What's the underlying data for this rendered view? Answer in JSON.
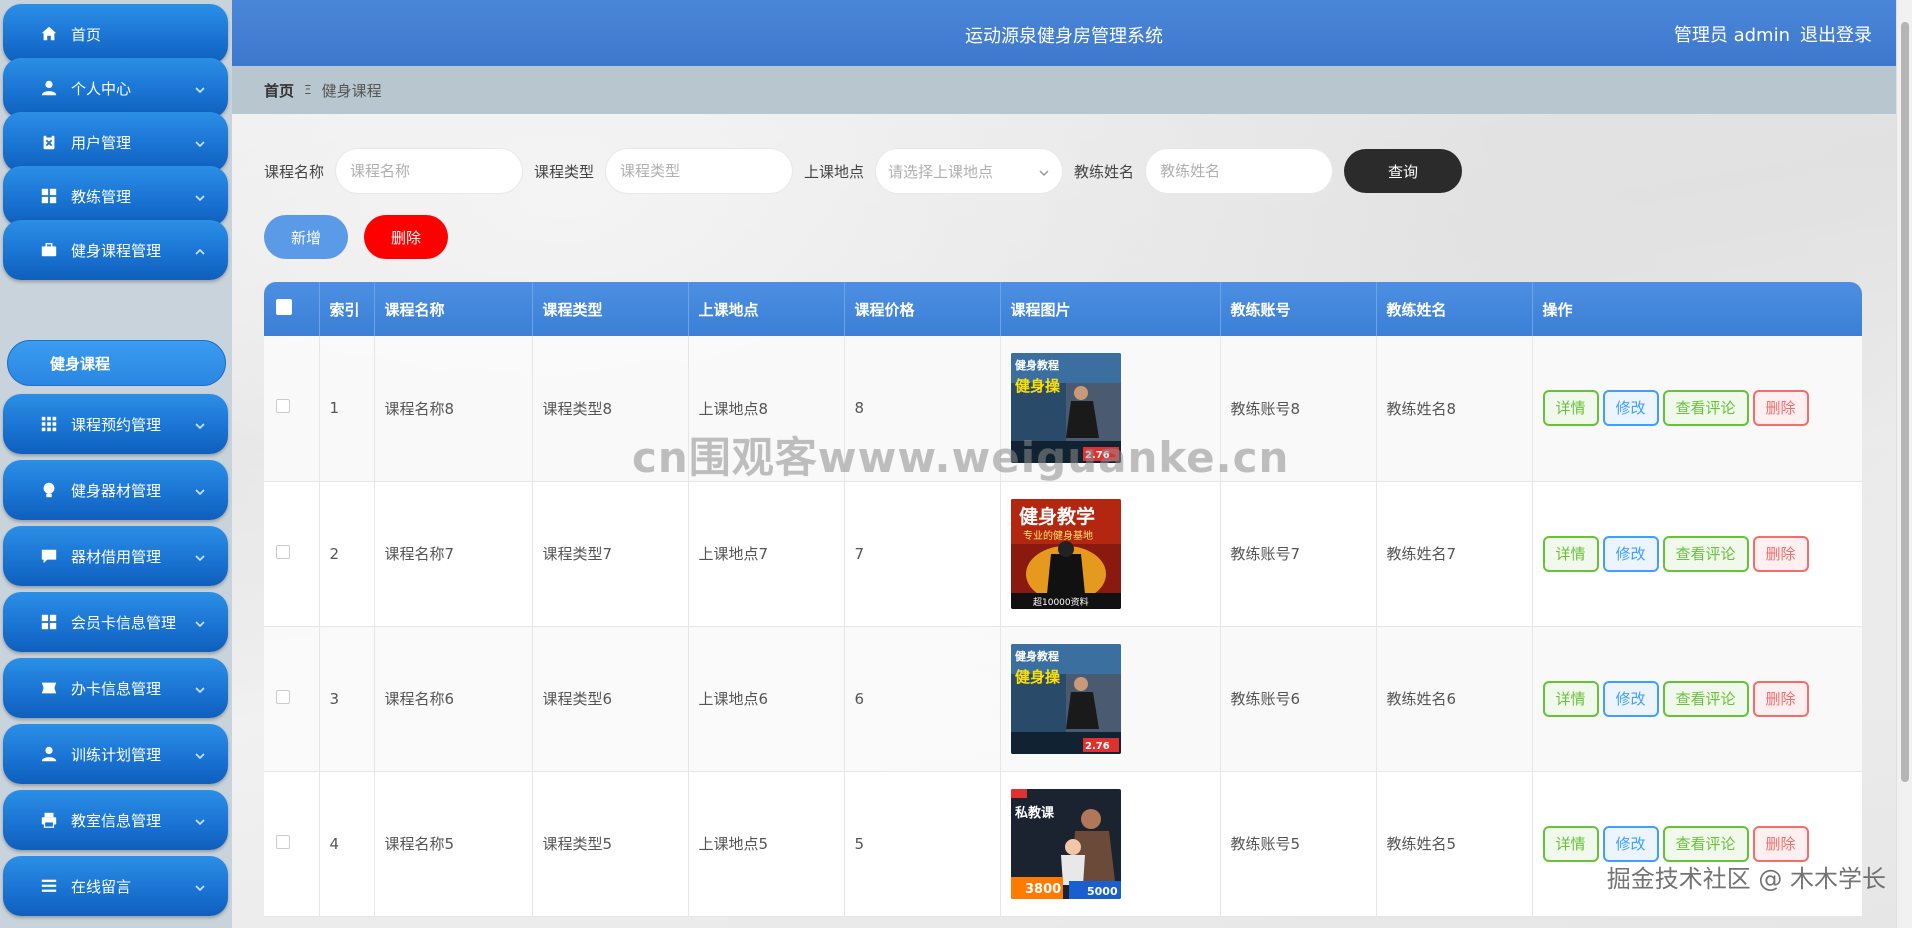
{
  "sidebar": {
    "items": [
      {
        "label": "首页",
        "icon": "home-icon"
      },
      {
        "label": "个人中心",
        "icon": "user-icon"
      },
      {
        "label": "用户管理",
        "icon": "clipboard-icon"
      },
      {
        "label": "教练管理",
        "icon": "grid-icon"
      },
      {
        "label": "健身课程管理",
        "icon": "briefcase-icon"
      },
      {
        "label": "课程预约管理",
        "icon": "apps-icon"
      },
      {
        "label": "健身器材管理",
        "icon": "bulb-icon"
      },
      {
        "label": "器材借用管理",
        "icon": "chat-icon"
      },
      {
        "label": "会员卡信息管理",
        "icon": "grid-icon"
      },
      {
        "label": "办卡信息管理",
        "icon": "ticket-icon"
      },
      {
        "label": "训练计划管理",
        "icon": "user-icon"
      },
      {
        "label": "教室信息管理",
        "icon": "printer-icon"
      },
      {
        "label": "在线留言",
        "icon": "list-icon"
      }
    ],
    "sub_item": "健身课程"
  },
  "header": {
    "title": "运动源泉健身房管理系统",
    "user": "管理员 admin",
    "logout": "退出登录"
  },
  "breadcrumb": {
    "home": "首页",
    "separator": "Ξ",
    "current": "健身课程"
  },
  "search": {
    "name_label": "课程名称",
    "name_placeholder": "课程名称",
    "type_label": "课程类型",
    "type_placeholder": "课程类型",
    "place_label": "上课地点",
    "place_placeholder": "请选择上课地点",
    "coach_label": "教练姓名",
    "coach_placeholder": "教练姓名",
    "query_button": "查询"
  },
  "actions": {
    "add": "新增",
    "delete": "删除"
  },
  "table": {
    "columns": [
      "索引",
      "课程名称",
      "课程类型",
      "上课地点",
      "课程价格",
      "课程图片",
      "教练账号",
      "教练姓名",
      "操作"
    ],
    "rows": [
      {
        "index": "1",
        "name": "课程名称8",
        "type": "课程类型8",
        "place": "上课地点8",
        "price": "8",
        "image": "fitness-poster-1",
        "account": "教练账号8",
        "coach": "教练姓名8"
      },
      {
        "index": "2",
        "name": "课程名称7",
        "type": "课程类型7",
        "place": "上课地点7",
        "price": "7",
        "image": "fitness-poster-2",
        "account": "教练账号7",
        "coach": "教练姓名7"
      },
      {
        "index": "3",
        "name": "课程名称6",
        "type": "课程类型6",
        "place": "上课地点6",
        "price": "6",
        "image": "fitness-poster-1",
        "account": "教练账号6",
        "coach": "教练姓名6"
      },
      {
        "index": "4",
        "name": "课程名称5",
        "type": "课程类型5",
        "place": "上课地点5",
        "price": "5",
        "image": "fitness-poster-3",
        "account": "教练账号5",
        "coach": "教练姓名5"
      }
    ],
    "ops": {
      "detail": "详情",
      "edit": "修改",
      "comments": "查看评论",
      "delete": "删除"
    }
  },
  "posters": {
    "p1_top": "健身教程",
    "p1_main": "健身操",
    "p1_price": "2.76",
    "p2_main": "健身教学",
    "p2_sub": "专业的健身基地",
    "p2_bottom": "超10000资料",
    "p3_main": "私教课",
    "p3_price1": "3800",
    "p3_price2": "5000"
  },
  "watermarks": {
    "center": "cn围观客www.weiguanke.cn",
    "corner": "掘金技术社区 @ 木木学长"
  },
  "colors": {
    "header": "#3e78cd",
    "sidebar_item": "#1a74d3",
    "delete_button": "#ff0000",
    "query_button": "#2b2b2b"
  }
}
